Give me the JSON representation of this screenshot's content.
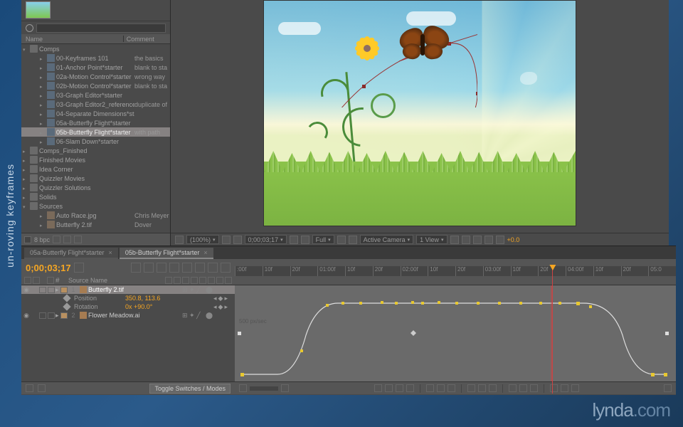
{
  "vertLabel": "un-roving keyframes",
  "project": {
    "searchPlaceholder": "",
    "cols": {
      "name": "Name",
      "comment": "Comment"
    },
    "tree": [
      {
        "t": "folder",
        "lbl": "Comps",
        "d": 0,
        "open": true
      },
      {
        "t": "comp",
        "lbl": "00-Keyframes 101",
        "cmt": "the basics",
        "d": 2
      },
      {
        "t": "comp",
        "lbl": "01-Anchor Point*starter",
        "cmt": "blank to sta",
        "d": 2
      },
      {
        "t": "comp",
        "lbl": "02a-Motion Control*starter",
        "cmt": "wrong way",
        "d": 2
      },
      {
        "t": "comp",
        "lbl": "02b-Motion Control*starter",
        "cmt": "blank to sta",
        "d": 2
      },
      {
        "t": "comp",
        "lbl": "03-Graph Editor*starter",
        "cmt": "",
        "d": 2
      },
      {
        "t": "comp",
        "lbl": "03-Graph Editor2_reference",
        "cmt": "duplicate of",
        "d": 2
      },
      {
        "t": "comp",
        "lbl": "04-Separate Dimensions*starter",
        "cmt": "",
        "d": 2
      },
      {
        "t": "comp",
        "lbl": "05a-Butterfly Flight*starter",
        "cmt": "",
        "d": 2
      },
      {
        "t": "comp",
        "lbl": "05b-Butterfly Flight*starter",
        "cmt": "with path",
        "d": 2,
        "sel": true
      },
      {
        "t": "comp",
        "lbl": "06-Slam Down*starter",
        "cmt": "",
        "d": 2
      },
      {
        "t": "folder",
        "lbl": "Comps_Finished",
        "d": 0
      },
      {
        "t": "folder",
        "lbl": "Finished Movies",
        "d": 0
      },
      {
        "t": "folder",
        "lbl": "Idea Corner",
        "d": 0
      },
      {
        "t": "folder",
        "lbl": "Quizzler Movies",
        "d": 0
      },
      {
        "t": "folder",
        "lbl": "Quizzler Solutions",
        "d": 0
      },
      {
        "t": "folder",
        "lbl": "Solids",
        "d": 0
      },
      {
        "t": "folder",
        "lbl": "Sources",
        "d": 0,
        "open": true
      },
      {
        "t": "file",
        "lbl": "Auto Race.jpg",
        "cmt": "Chris Meyer",
        "d": 2
      },
      {
        "t": "file",
        "lbl": "Butterfly 2.tif",
        "cmt": "Dover",
        "d": 2
      }
    ],
    "bpc": "8 bpc"
  },
  "viewer": {
    "zoom": "(100%)",
    "time": "0;00;03;17",
    "res": "Full",
    "camera": "Active Camera",
    "views": "1 View",
    "exposure": "+0.0"
  },
  "timeline": {
    "tabs": [
      {
        "lbl": "05a-Butterfly Flight*starter",
        "active": false
      },
      {
        "lbl": "05b-Butterfly Flight*starter",
        "active": true
      }
    ],
    "timecode": "0;00;03;17",
    "srcName": "Source Name",
    "ruler": [
      ":00f",
      "10f",
      "20f",
      "01:00f",
      "10f",
      "20f",
      "02:00f",
      "10f",
      "20f",
      "03:00f",
      "10f",
      "20f",
      "04:00f",
      "10f",
      "20f",
      "05:0"
    ],
    "layers": [
      {
        "num": "1",
        "name": "Butterfly 2.tif",
        "sel": true,
        "props": [
          {
            "name": "Position",
            "val": "350.8, 113.6"
          },
          {
            "name": "Rotation",
            "val": "0x +90.0°"
          }
        ]
      },
      {
        "num": "2",
        "name": "Flower Meadow.ai",
        "sel": false
      }
    ],
    "graphYLabel": "500 px/sec",
    "toggle": "Toggle Switches / Modes"
  },
  "logo": {
    "a": "lynda",
    "b": ".com"
  }
}
